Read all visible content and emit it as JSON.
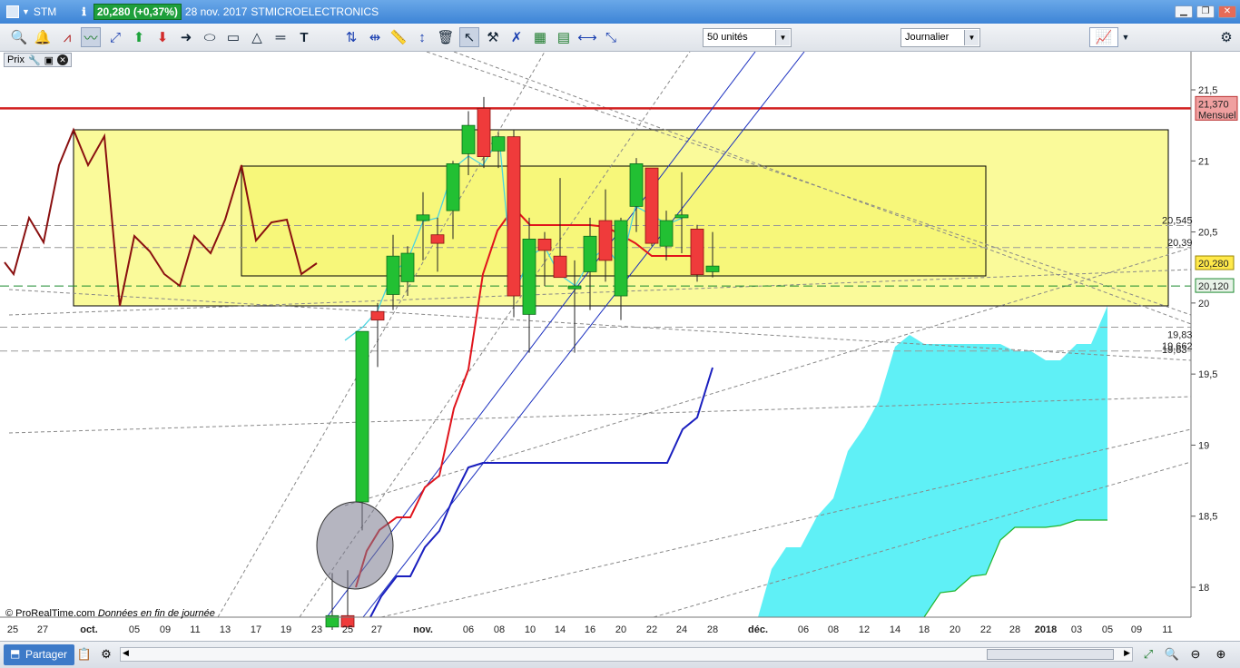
{
  "titlebar": {
    "symbol": "STM",
    "quote": "20,280 (+0,37%)",
    "date": "28 nov. 2017",
    "name": "STMICROELECTRONICS"
  },
  "toolbar": {
    "units_select": "50 unités",
    "period_select": "Journalier",
    "tools": [
      "zoom-icon",
      "alert-icon",
      "trend-icon",
      "indicator-icon",
      "crosshair-icon",
      "buy-arrow-icon",
      "sell-arrow-icon",
      "right-arrow-icon",
      "ellipse-icon",
      "rectangle-icon",
      "triangle-icon",
      "line-icon",
      "text-icon",
      "vertical-line-icon",
      "fibonacci-icon",
      "ruler-icon",
      "vertical-cursor-icon",
      "trash-icon",
      "pointer-icon",
      "magnet-icon",
      "cross-icon",
      "table1-icon",
      "table2-icon",
      "hline-icon",
      "diagonal-icon"
    ]
  },
  "prix_label": "Prix",
  "copyright": "© ProRealTime.com",
  "copyright_note": "Données en fin de journée",
  "partager_label": "Partager",
  "price_axis": {
    "ticks": [
      "21,5",
      "21",
      "20,5",
      "20",
      "19,5",
      "19",
      "18,5",
      "18"
    ],
    "current_price": "20,280",
    "resistance_price": "21,370",
    "resistance_label": "Mensuel",
    "green_level": "20,120",
    "label_20545": "20,545",
    "label_2039": "20,39",
    "label_1983": "19,83",
    "label_19662": "19,662",
    "label_1963": "19,63"
  },
  "date_axis": [
    "25",
    "27",
    "oct.",
    "05",
    "09",
    "11",
    "13",
    "17",
    "19",
    "23",
    "25",
    "27",
    "nov.",
    "06",
    "08",
    "10",
    "14",
    "16",
    "20",
    "22",
    "24",
    "28",
    "déc.",
    "06",
    "08",
    "12",
    "14",
    "18",
    "20",
    "22",
    "28",
    "2018",
    "03",
    "05",
    "09",
    "11"
  ],
  "chart_data": {
    "type": "candlestick",
    "candles": [
      {
        "date": "25 oct",
        "open": 17.72,
        "high": 18.1,
        "low": 17.7,
        "close": 17.8
      },
      {
        "date": "26 oct",
        "open": 17.8,
        "high": 18.12,
        "low": 17.75,
        "close": 17.72
      },
      {
        "date": "26 oct b",
        "open": 18.6,
        "high": 19.8,
        "low": 18.4,
        "close": 19.8
      },
      {
        "date": "27 oct",
        "open": 19.94,
        "high": 20.0,
        "low": 19.55,
        "close": 19.88
      },
      {
        "date": "30 oct",
        "open": 20.06,
        "high": 20.48,
        "low": 19.95,
        "close": 20.33
      },
      {
        "date": "31 oct",
        "open": 20.15,
        "high": 20.4,
        "low": 20.05,
        "close": 20.35
      },
      {
        "date": "01 nov",
        "open": 20.58,
        "high": 20.78,
        "low": 20.3,
        "close": 20.62
      },
      {
        "date": "02 nov",
        "open": 20.48,
        "high": 20.6,
        "low": 20.22,
        "close": 20.42
      },
      {
        "date": "03 nov",
        "open": 20.65,
        "high": 21.0,
        "low": 20.45,
        "close": 20.98
      },
      {
        "date": "06 nov",
        "open": 21.05,
        "high": 21.35,
        "low": 20.9,
        "close": 21.25
      },
      {
        "date": "07 nov",
        "open": 21.37,
        "high": 21.45,
        "low": 20.95,
        "close": 21.03
      },
      {
        "date": "08 nov",
        "open": 21.07,
        "high": 21.2,
        "low": 20.95,
        "close": 21.17
      },
      {
        "date": "09 nov",
        "open": 21.17,
        "high": 21.22,
        "low": 19.9,
        "close": 20.05
      },
      {
        "date": "10 nov",
        "open": 19.92,
        "high": 20.6,
        "low": 19.65,
        "close": 20.45
      },
      {
        "date": "13 nov",
        "open": 20.45,
        "high": 20.5,
        "low": 20.12,
        "close": 20.37
      },
      {
        "date": "14 nov",
        "open": 20.33,
        "high": 20.88,
        "low": 20.2,
        "close": 20.18
      },
      {
        "date": "15 nov",
        "open": 20.1,
        "high": 20.3,
        "low": 19.65,
        "close": 20.12
      },
      {
        "date": "16 nov",
        "open": 20.22,
        "high": 20.6,
        "low": 19.95,
        "close": 20.47
      },
      {
        "date": "17 nov",
        "open": 20.58,
        "high": 20.8,
        "low": 20.15,
        "close": 20.3
      },
      {
        "date": "20 nov",
        "open": 20.05,
        "high": 20.6,
        "low": 19.88,
        "close": 20.58
      },
      {
        "date": "21 nov",
        "open": 20.68,
        "high": 21.02,
        "low": 20.5,
        "close": 20.98
      },
      {
        "date": "22 nov",
        "open": 20.95,
        "high": 20.95,
        "low": 20.4,
        "close": 20.42
      },
      {
        "date": "23 nov",
        "open": 20.4,
        "high": 20.65,
        "low": 20.3,
        "close": 20.58
      },
      {
        "date": "24 nov",
        "open": 20.6,
        "high": 20.92,
        "low": 20.35,
        "close": 20.62
      },
      {
        "date": "27 nov",
        "open": 20.52,
        "high": 20.55,
        "low": 20.15,
        "close": 20.2
      },
      {
        "date": "28 nov",
        "open": 20.22,
        "high": 20.5,
        "low": 20.18,
        "close": 20.26
      }
    ],
    "ylim": [
      17.8,
      21.8
    ],
    "levels": {
      "resistance": 21.37,
      "green": 20.12,
      "grey1": 20.545,
      "grey2": 20.39,
      "grey3": 19.83,
      "grey4": 19.662
    },
    "grid": false
  }
}
